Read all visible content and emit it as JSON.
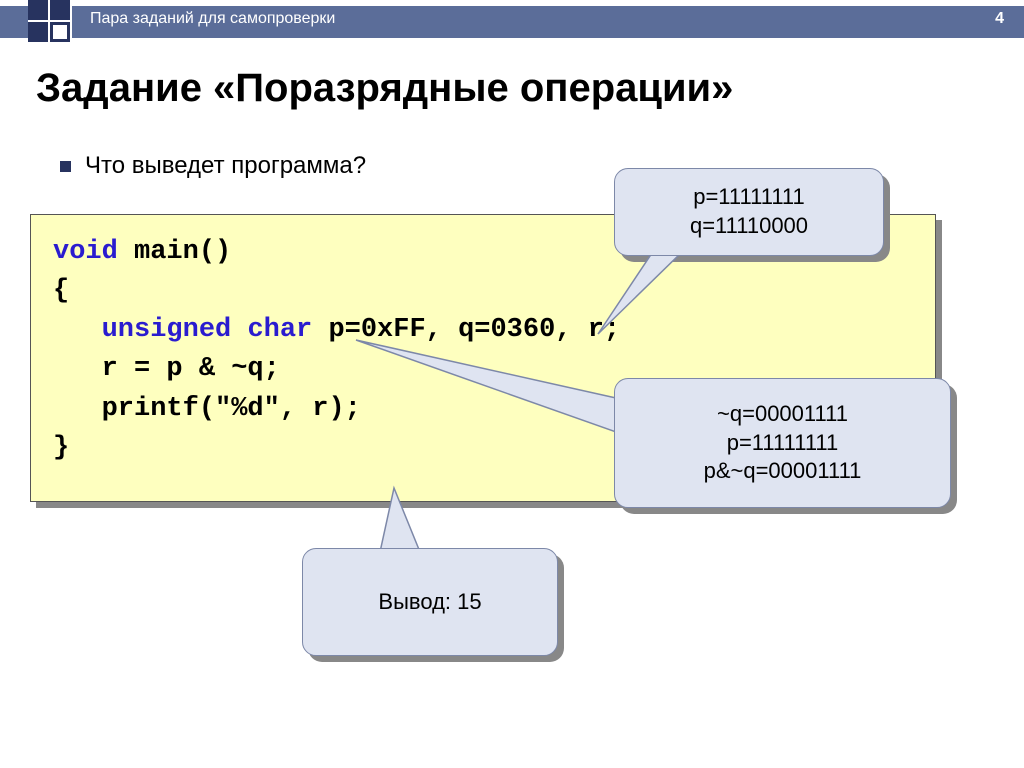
{
  "header": {
    "breadcrumb": "Пара заданий для самопроверки",
    "page_number": "4"
  },
  "title": "Задание «Поразрядные операции»",
  "bullet": "Что выведет программа?",
  "code": {
    "line1_kw": "void",
    "line1_rest": " main()",
    "line2": "{",
    "line3_kw1": "unsigned",
    "line3_mid": " ",
    "line3_kw2": "char",
    "line3_rest": " p=0xFF, q=0360, r;",
    "line4": "   r = p & ~q;",
    "line5": "   printf(\"%d\", r);",
    "line6": "}"
  },
  "callouts": {
    "c1": {
      "l1": "p=11111111",
      "l2": "q=11110000"
    },
    "c2": {
      "l1": "~q=00001111",
      "l2": "p=11111111",
      "l3": "p&~q=00001111"
    },
    "c3": {
      "l1": "Вывод: 15"
    }
  }
}
